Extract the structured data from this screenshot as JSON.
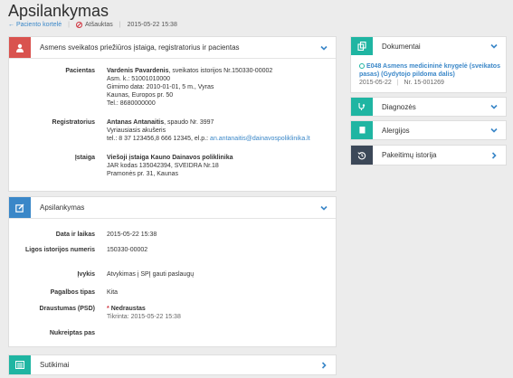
{
  "header": {
    "title": "Apsilankymas",
    "back_link": "← Paciento kortelė",
    "status": "Atšauktas",
    "datetime": "2015-05-22 15:38"
  },
  "institution_panel": {
    "title": "Asmens sveikatos priežiūros įstaiga, registratorius ir pacientas",
    "patient_label": "Pacientas",
    "patient_name": "Vardenis Pavardenis",
    "patient_history": ", sveikatos istorijos Nr.150330-00002",
    "patient_code": "Asm. k.: 51001010000",
    "patient_birth": "Gimimo data: 2010-01-01, 5 m., Vyras",
    "patient_address": "Kaunas, Europos pr. 50",
    "patient_phone": "Tel.: 8680000000",
    "registrar_label": "Registratorius",
    "registrar_name": "Antanas Antanaitis",
    "registrar_stamp": ", spaudo Nr. 3997",
    "registrar_role": "Vyriausiasis akušeris",
    "registrar_contacts": "tel.: 8 37 123456,8 666 12345, el.p.: ",
    "registrar_email": "an.antanaitis@dainavospoliklinika.lt",
    "org_label": "Įstaiga",
    "org_name": "Viešoji įstaiga Kauno Dainavos poliklinika",
    "org_code": "JAR kodas 135042394, SVEIDRA Nr.18",
    "org_address": "Pramonės pr. 31, Kaunas"
  },
  "visit_panel": {
    "title": "Apsilankymas",
    "rows": [
      {
        "label": "Data ir laikas",
        "value": "2015-05-22 15:38"
      },
      {
        "label": "Ligos istorijos numeris",
        "value": "150330-00002"
      },
      {
        "label": "Įvykis",
        "value": "Atvykimas į SPĮ gauti paslaugų"
      },
      {
        "label": "Pagalbos tipas",
        "value": "Kita"
      }
    ],
    "insured_label": "Draustumas (PSD)",
    "insured_star": "*",
    "insured_value": "Nedraustas",
    "insured_checked": "Tikrinta: 2015-05-22 15:38",
    "referred_label": "Nukreiptas pas"
  },
  "consents_panel": {
    "title": "Sutikimai"
  },
  "documents_panel": {
    "title": "Dokumentai",
    "doc_title": "E048 Asmens medicininė knygelė (sveikatos pasas) (Gydytojo pildoma dalis)",
    "doc_date": "2015-05-22",
    "doc_number": "Nr. 15-001269"
  },
  "diagnoses_panel": {
    "title": "Diagnozės"
  },
  "allergies_panel": {
    "title": "Alergijos"
  },
  "history_panel": {
    "title": "Pakeitimų istorija"
  },
  "colors": {
    "red": "#d9534f",
    "blue": "#3a87c8",
    "teal": "#1fb5a2",
    "dark": "#3c4858"
  }
}
